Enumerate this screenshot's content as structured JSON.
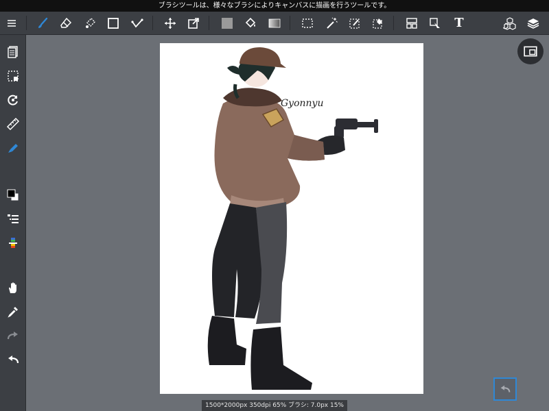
{
  "tip_text": "ブラシツールは、様々なブラシによりキャンバスに描画を行うツールです。",
  "status_text": "1500*2000px 350dpi 65% ブラシ: 7.0px 15%",
  "canvas_signature": "Gyonnyu",
  "colors": {
    "accent": "#2f88d6",
    "toolbar_bg": "#3c3f44",
    "workspace_bg": "#6b6f75",
    "icon": "#ffffff",
    "fill_gray": "#9a9a9a"
  },
  "toolbar": {
    "menu_icon": "menu-icon",
    "tools": [
      "brush-icon",
      "eraser-icon",
      "blur-eraser-icon",
      "rectangle-shape-icon",
      "check-stroke-icon",
      "move-icon",
      "transform-icon",
      "fill-color-icon",
      "bucket-icon",
      "gradient-icon",
      "rect-select-icon",
      "magic-wand-icon",
      "lasso-select-icon",
      "select-pen-icon",
      "frame-icon",
      "select-move-icon"
    ],
    "text_tool_label": "T",
    "right": [
      "3d-cubes-icon",
      "layers-icon"
    ]
  },
  "sidebar": {
    "items": [
      "pages-icon",
      "selection-icon",
      "rotate-icon",
      "ruler-icon",
      "brush-marker-icon",
      "color-swatch-icon",
      "layer-list-icon",
      "color-palette-icon",
      "hand-icon",
      "eyedropper-icon",
      "redo-icon",
      "undo-icon"
    ]
  }
}
